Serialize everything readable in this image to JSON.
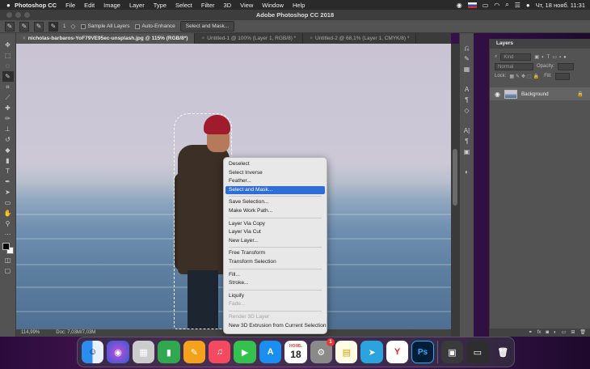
{
  "menubar": {
    "apple": "",
    "items": [
      "Photoshop CC",
      "File",
      "Edit",
      "Image",
      "Layer",
      "Type",
      "Select",
      "Filter",
      "3D",
      "View",
      "Window",
      "Help"
    ],
    "clock": "Чт, 18 нояб. 11:31"
  },
  "window": {
    "title": "Adobe Photoshop CC 2018"
  },
  "options": {
    "size": "1",
    "sample_all_layers": "Sample All Layers",
    "auto_enhance": "Auto-Enhance",
    "select_and_mask": "Select and Mask..."
  },
  "tabs": [
    {
      "label": "nicholas-barbaros-YoF79VE95ec-unsplash.jpg @ 115% (RGB/8*)",
      "close": "×"
    },
    {
      "label": "Untitled-1 @ 100% (Layer 1, RGB/8) *",
      "close": "×"
    },
    {
      "label": "Untitled-2 @ 68,1% (Layer 1, CMYK/8) *",
      "close": "×"
    }
  ],
  "status": {
    "zoom": "114,99%",
    "doc": "Doc: 7,03M/7,03M"
  },
  "context_menu": {
    "groups": [
      [
        {
          "label": "Deselect"
        },
        {
          "label": "Select Inverse"
        },
        {
          "label": "Feather..."
        },
        {
          "label": "Select and Mask...",
          "highlight": true
        }
      ],
      [
        {
          "label": "Save Selection..."
        },
        {
          "label": "Make Work Path..."
        }
      ],
      [
        {
          "label": "Layer Via Copy"
        },
        {
          "label": "Layer Via Cut"
        },
        {
          "label": "New Layer..."
        }
      ],
      [
        {
          "label": "Free Transform"
        },
        {
          "label": "Transform Selection"
        }
      ],
      [
        {
          "label": "Fill..."
        },
        {
          "label": "Stroke..."
        }
      ],
      [
        {
          "label": "Liquify"
        },
        {
          "label": "Fade...",
          "disabled": true
        }
      ],
      [
        {
          "label": "Render 3D Layer",
          "disabled": true
        },
        {
          "label": "New 3D Extrusion from Current Selection"
        }
      ]
    ]
  },
  "layers_panel": {
    "title": "Layers",
    "kind": "Kind",
    "blend_mode": "Normal",
    "opacity_label": "Opacity:",
    "lock_label": "Lock:",
    "fill_label": "Fill:",
    "layer_name": "Background"
  },
  "dock": {
    "calendar_month": "НОЯБ.",
    "calendar_day": "18",
    "badge": "1",
    "ps_label": "Ps"
  },
  "colors": {
    "highlight": "#2e6ed6",
    "ps_blue": "#001e36",
    "ps_text": "#31a8ff"
  }
}
